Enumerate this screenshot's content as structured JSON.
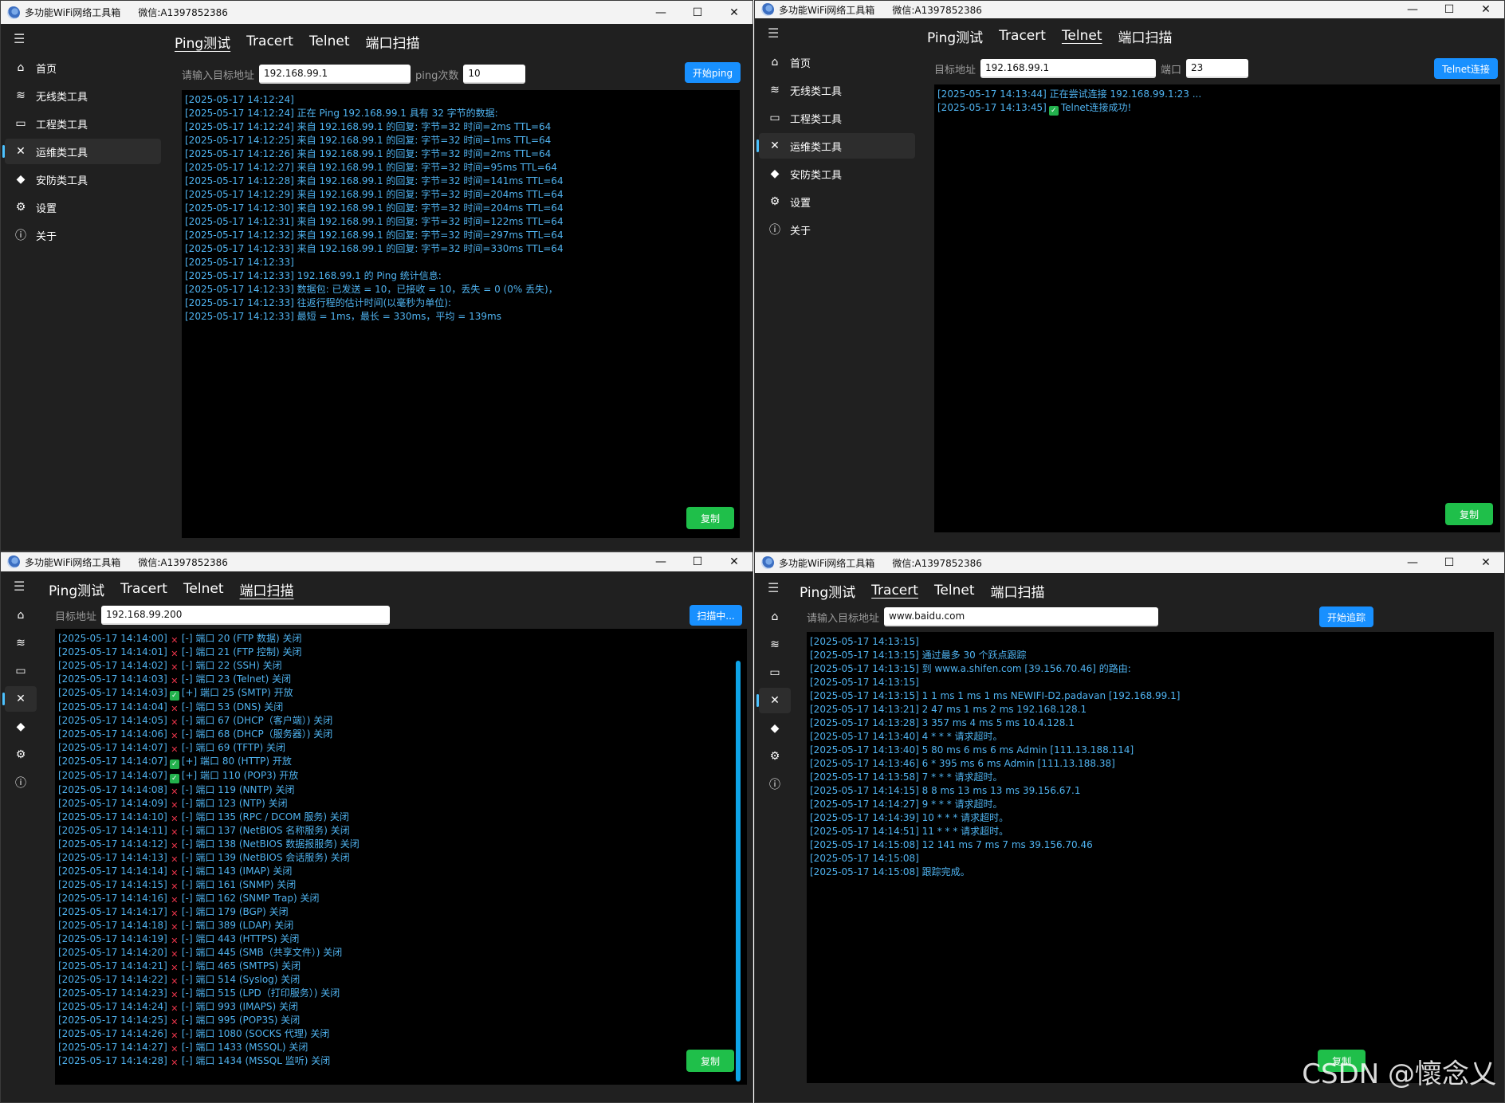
{
  "app": {
    "title": "多功能WiFi网络工具箱",
    "wechat": "微信:A1397852386",
    "min": "—",
    "max": "☐",
    "close": "✕",
    "menu": "☰"
  },
  "nav": [
    {
      "label": "首页",
      "icon": "home-icon",
      "glyph": "⌂"
    },
    {
      "label": "无线类工具",
      "icon": "wifi-icon",
      "glyph": "≋"
    },
    {
      "label": "工程类工具",
      "icon": "toolbox-icon",
      "glyph": "▭"
    },
    {
      "label": "运维类工具",
      "icon": "wrench-icon",
      "glyph": "✕"
    },
    {
      "label": "安防类工具",
      "icon": "shield-icon",
      "glyph": "◆"
    },
    {
      "label": "设置",
      "icon": "gear-icon",
      "glyph": "⚙"
    },
    {
      "label": "关于",
      "icon": "info-icon",
      "glyph": "ⓘ"
    }
  ],
  "tabs": [
    "Ping测试",
    "Tracert",
    "Telnet",
    "端口扫描"
  ],
  "ping": {
    "target_label": "请输入目标地址",
    "target_value": "192.168.99.1",
    "count_label": "ping次数",
    "count_value": "10",
    "start_label": "开始ping",
    "copy_label": "复制",
    "lines": [
      "[2025-05-17 14:12:24]",
      "[2025-05-17 14:12:24] 正在 Ping 192.168.99.1 具有 32 字节的数据:",
      "[2025-05-17 14:12:24] 来自 192.168.99.1 的回复: 字节=32 时间=2ms TTL=64",
      "[2025-05-17 14:12:25] 来自 192.168.99.1 的回复: 字节=32 时间=1ms TTL=64",
      "[2025-05-17 14:12:26] 来自 192.168.99.1 的回复: 字节=32 时间=2ms TTL=64",
      "[2025-05-17 14:12:27] 来自 192.168.99.1 的回复: 字节=32 时间=95ms TTL=64",
      "[2025-05-17 14:12:28] 来自 192.168.99.1 的回复: 字节=32 时间=141ms TTL=64",
      "[2025-05-17 14:12:29] 来自 192.168.99.1 的回复: 字节=32 时间=204ms TTL=64",
      "[2025-05-17 14:12:30] 来自 192.168.99.1 的回复: 字节=32 时间=204ms TTL=64",
      "[2025-05-17 14:12:31] 来自 192.168.99.1 的回复: 字节=32 时间=122ms TTL=64",
      "[2025-05-17 14:12:32] 来自 192.168.99.1 的回复: 字节=32 时间=297ms TTL=64",
      "[2025-05-17 14:12:33] 来自 192.168.99.1 的回复: 字节=32 时间=330ms TTL=64",
      "[2025-05-17 14:12:33]",
      "[2025-05-17 14:12:33] 192.168.99.1 的 Ping 统计信息:",
      "[2025-05-17 14:12:33] 数据包: 已发送 = 10，已接收 = 10，丢失 = 0 (0% 丢失)，",
      "[2025-05-17 14:12:33] 往返行程的估计时间(以毫秒为单位):",
      "[2025-05-17 14:12:33] 最短 = 1ms，最长 = 330ms，平均 = 139ms"
    ]
  },
  "telnet": {
    "target_label": "目标地址",
    "target_value": "192.168.99.1",
    "port_label": "端口",
    "port_value": "23",
    "connect_label": "Telnet连接",
    "copy_label": "复制",
    "lines": [
      {
        "text": "[2025-05-17 14:13:44] 正在尝试连接 192.168.99.1:23 ...",
        "mark": ""
      },
      {
        "text": "Telnet连接成功!",
        "prefix": "[2025-05-17 14:13:45]",
        "mark": "ok"
      }
    ]
  },
  "portscan": {
    "target_label": "目标地址",
    "target_value": "192.168.99.200",
    "scan_label": "扫描中...",
    "copy_label": "复制",
    "lines": [
      {
        "ts": "[2025-05-17 14:14:00]",
        "mark": "x",
        "text": "[-] 端口 20 (FTP 数据) 关闭"
      },
      {
        "ts": "[2025-05-17 14:14:01]",
        "mark": "x",
        "text": "[-] 端口 21 (FTP 控制) 关闭"
      },
      {
        "ts": "[2025-05-17 14:14:02]",
        "mark": "x",
        "text": "[-] 端口 22 (SSH) 关闭"
      },
      {
        "ts": "[2025-05-17 14:14:03]",
        "mark": "x",
        "text": "[-] 端口 23 (Telnet) 关闭"
      },
      {
        "ts": "[2025-05-17 14:14:03]",
        "mark": "ok",
        "text": "[+] 端口 25 (SMTP) 开放"
      },
      {
        "ts": "[2025-05-17 14:14:04]",
        "mark": "x",
        "text": "[-] 端口 53 (DNS) 关闭"
      },
      {
        "ts": "[2025-05-17 14:14:05]",
        "mark": "x",
        "text": "[-] 端口 67 (DHCP（客户端）) 关闭"
      },
      {
        "ts": "[2025-05-17 14:14:06]",
        "mark": "x",
        "text": "[-] 端口 68 (DHCP（服务器）) 关闭"
      },
      {
        "ts": "[2025-05-17 14:14:07]",
        "mark": "x",
        "text": "[-] 端口 69 (TFTP) 关闭"
      },
      {
        "ts": "[2025-05-17 14:14:07]",
        "mark": "ok",
        "text": "[+] 端口 80 (HTTP) 开放"
      },
      {
        "ts": "[2025-05-17 14:14:07]",
        "mark": "ok",
        "text": "[+] 端口 110 (POP3) 开放"
      },
      {
        "ts": "[2025-05-17 14:14:08]",
        "mark": "x",
        "text": "[-] 端口 119 (NNTP) 关闭"
      },
      {
        "ts": "[2025-05-17 14:14:09]",
        "mark": "x",
        "text": "[-] 端口 123 (NTP) 关闭"
      },
      {
        "ts": "[2025-05-17 14:14:10]",
        "mark": "x",
        "text": "[-] 端口 135 (RPC / DCOM 服务) 关闭"
      },
      {
        "ts": "[2025-05-17 14:14:11]",
        "mark": "x",
        "text": "[-] 端口 137 (NetBIOS 名称服务) 关闭"
      },
      {
        "ts": "[2025-05-17 14:14:12]",
        "mark": "x",
        "text": "[-] 端口 138 (NetBIOS 数据报服务) 关闭"
      },
      {
        "ts": "[2025-05-17 14:14:13]",
        "mark": "x",
        "text": "[-] 端口 139 (NetBIOS 会话服务) 关闭"
      },
      {
        "ts": "[2025-05-17 14:14:14]",
        "mark": "x",
        "text": "[-] 端口 143 (IMAP) 关闭"
      },
      {
        "ts": "[2025-05-17 14:14:15]",
        "mark": "x",
        "text": "[-] 端口 161 (SNMP) 关闭"
      },
      {
        "ts": "[2025-05-17 14:14:16]",
        "mark": "x",
        "text": "[-] 端口 162 (SNMP Trap) 关闭"
      },
      {
        "ts": "[2025-05-17 14:14:17]",
        "mark": "x",
        "text": "[-] 端口 179 (BGP) 关闭"
      },
      {
        "ts": "[2025-05-17 14:14:18]",
        "mark": "x",
        "text": "[-] 端口 389 (LDAP) 关闭"
      },
      {
        "ts": "[2025-05-17 14:14:19]",
        "mark": "x",
        "text": "[-] 端口 443 (HTTPS) 关闭"
      },
      {
        "ts": "[2025-05-17 14:14:20]",
        "mark": "x",
        "text": "[-] 端口 445 (SMB（共享文件）) 关闭"
      },
      {
        "ts": "[2025-05-17 14:14:21]",
        "mark": "x",
        "text": "[-] 端口 465 (SMTPS) 关闭"
      },
      {
        "ts": "[2025-05-17 14:14:22]",
        "mark": "x",
        "text": "[-] 端口 514 (Syslog) 关闭"
      },
      {
        "ts": "[2025-05-17 14:14:23]",
        "mark": "x",
        "text": "[-] 端口 515 (LPD（打印服务）) 关闭"
      },
      {
        "ts": "[2025-05-17 14:14:24]",
        "mark": "x",
        "text": "[-] 端口 993 (IMAPS) 关闭"
      },
      {
        "ts": "[2025-05-17 14:14:25]",
        "mark": "x",
        "text": "[-] 端口 995 (POP3S) 关闭"
      },
      {
        "ts": "[2025-05-17 14:14:26]",
        "mark": "x",
        "text": "[-] 端口 1080 (SOCKS 代理) 关闭"
      },
      {
        "ts": "[2025-05-17 14:14:27]",
        "mark": "x",
        "text": "[-] 端口 1433 (MSSQL) 关闭"
      },
      {
        "ts": "[2025-05-17 14:14:28]",
        "mark": "x",
        "text": "[-] 端口 1434 (MSSQL 监听) 关闭"
      }
    ]
  },
  "tracert": {
    "target_label": "请输入目标地址",
    "target_value": "www.baidu.com",
    "start_label": "开始追踪",
    "copy_label": "复制",
    "lines": [
      "[2025-05-17 14:13:15]",
      "[2025-05-17 14:13:15] 通过最多 30 个跃点跟踪",
      "[2025-05-17 14:13:15] 到 www.a.shifen.com [39.156.70.46] 的路由:",
      "[2025-05-17 14:13:15]",
      "[2025-05-17 14:13:15] 1      1 ms      1 ms      1 ms  NEWIFI-D2.padavan [192.168.99.1]",
      "[2025-05-17 14:13:21] 2     47 ms      1 ms      2 ms  192.168.128.1",
      "[2025-05-17 14:13:28] 3    357 ms      4 ms      5 ms  10.4.128.1",
      "[2025-05-17 14:13:40] 4      *         *         *     请求超时。",
      "[2025-05-17 14:13:40] 5     80 ms      6 ms      6 ms  Admin [111.13.188.114]",
      "[2025-05-17 14:13:46] 6      *      395 ms      6 ms  Admin [111.13.188.38]",
      "[2025-05-17 14:13:58] 7      *         *         *     请求超时。",
      "[2025-05-17 14:14:15] 8      8 ms     13 ms     13 ms  39.156.67.1",
      "[2025-05-17 14:14:27] 9      *         *         *     请求超时。",
      "[2025-05-17 14:14:39] 10     *         *         *     请求超时。",
      "[2025-05-17 14:14:51] 11     *         *         *     请求超时。",
      "[2025-05-17 14:15:08] 12   141 ms      7 ms      7 ms  39.156.70.46",
      "[2025-05-17 14:15:08]",
      "[2025-05-17 14:15:08] 跟踪完成。"
    ]
  },
  "watermark": "CSDN @懷念乂",
  "colors": {
    "accent": "#4cc2ff",
    "button_blue": "#1890ff",
    "button_green": "#1fbf4a",
    "console_text": "#4fb3f0",
    "error": "#e8344a",
    "ok": "#23b14d"
  }
}
